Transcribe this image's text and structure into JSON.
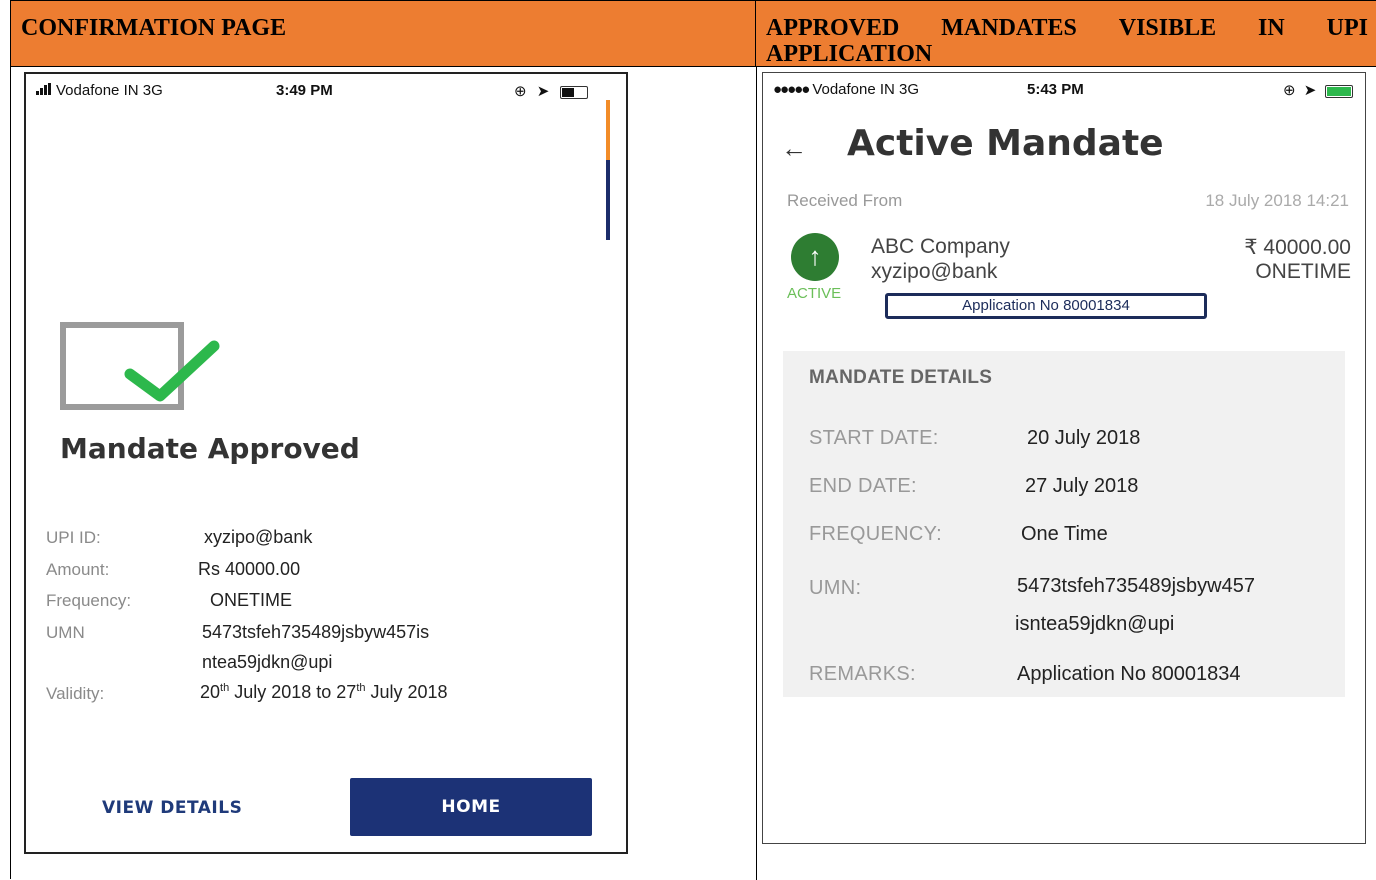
{
  "headers": {
    "left": "CONFIRMATION PAGE",
    "right_words": [
      "APPROVED",
      "MANDATES",
      "VISIBLE",
      "IN",
      "UPI"
    ],
    "right_line2": "APPLICATION"
  },
  "left_phone": {
    "status_bar": {
      "carrier": "Vodafone IN  3G",
      "time": "3:49 PM"
    },
    "title": "Mandate Approved",
    "details": {
      "upi_label": "UPI ID:",
      "upi_value": "xyzipo@bank",
      "amount_label": "Amount:",
      "amount_value": "Rs 40000.00",
      "frequency_label": "Frequency:",
      "frequency_value": "ONETIME",
      "umn_label": "UMN",
      "umn_line1": "5473tsfeh735489jsbyw457is",
      "umn_line2": "ntea59jdkn@upi",
      "validity_label": "Validity:",
      "validity_start_day": "20",
      "validity_sup1": "th",
      "validity_start_rest": " July 2018 to ",
      "validity_end_day": "27",
      "validity_sup2": "th",
      "validity_end_rest": " July 2018"
    },
    "buttons": {
      "view_details": "VIEW DETAILS",
      "home": "HOME"
    }
  },
  "right_phone": {
    "status_bar": {
      "carrier": "Vodafone IN  3G",
      "time": "5:43 PM"
    },
    "back_glyph": "←",
    "title": "Active Mandate",
    "received_label": "Received From",
    "received_date": "18 July 2018 14:21",
    "up_glyph": "↑",
    "payee": {
      "name": "ABC Company",
      "upi": "xyzipo@bank",
      "amount": "₹ 40000.00",
      "frequency": "ONETIME",
      "status": "ACTIVE",
      "application_no": "Application No 80001834"
    },
    "mandate_details": {
      "title": "MANDATE DETAILS",
      "start_label": "START DATE:",
      "start_value": "20 July 2018",
      "end_label": "END DATE:",
      "end_value": "27 July 2018",
      "frequency_label": "FREQUENCY:",
      "frequency_value": "One Time",
      "umn_label": "UMN:",
      "umn_line1": "5473tsfeh735489jsbyw457",
      "umn_line2": "isntea59jdkn@upi",
      "remarks_label": "REMARKS:",
      "remarks_value": "Application No 80001834"
    }
  },
  "colors": {
    "header_bg": "#ed7d31",
    "home_button": "#1c3276",
    "active_green": "#2e7d32",
    "check_green": "#2db84c"
  }
}
